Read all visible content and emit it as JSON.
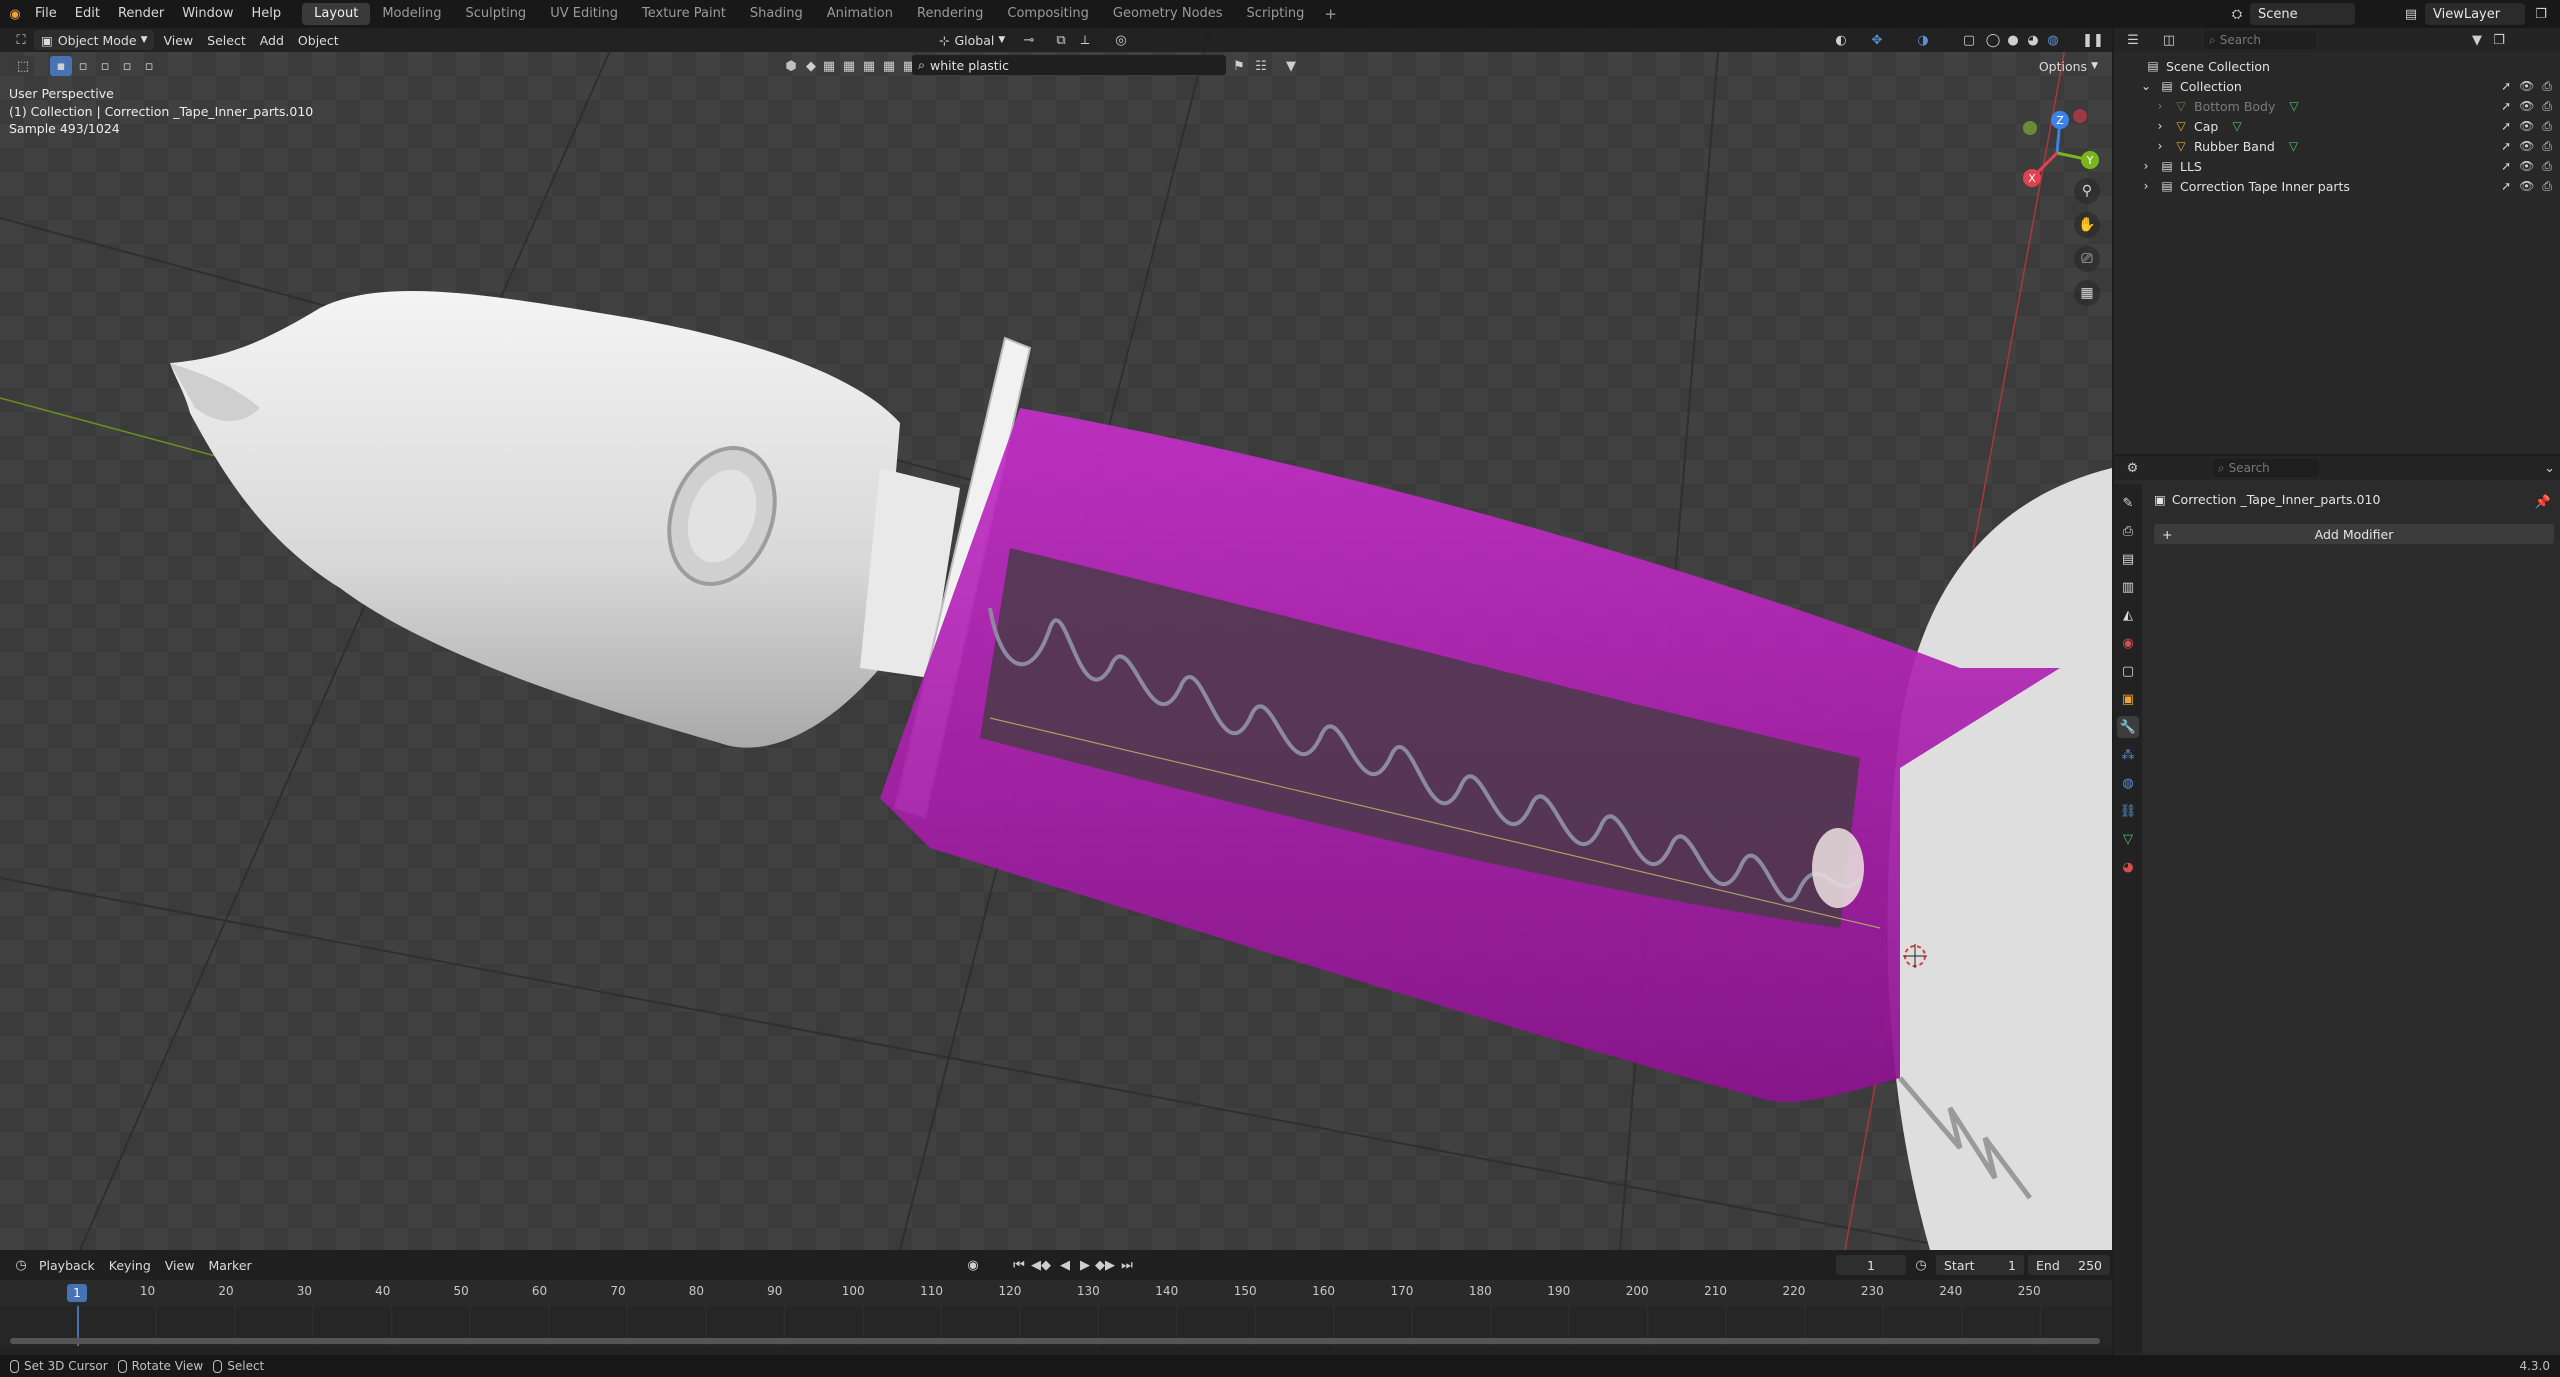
{
  "menubar": {
    "items": [
      "File",
      "Edit",
      "Render",
      "Window",
      "Help"
    ],
    "workspaces": [
      "Layout",
      "Modeling",
      "Sculpting",
      "UV Editing",
      "Texture Paint",
      "Shading",
      "Animation",
      "Rendering",
      "Compositing",
      "Geometry Nodes",
      "Scripting"
    ],
    "active_workspace": "Layout",
    "scene": "Scene",
    "view_layer": "ViewLayer"
  },
  "viewport": {
    "mode": "Object Mode",
    "menus": [
      "View",
      "Select",
      "Add",
      "Object"
    ],
    "transform_orientation": "Global",
    "material_search": "white plastic",
    "options_label": "Options",
    "info_lines": [
      "User Perspective",
      "(1) Collection | Correction _Tape_Inner_parts.010",
      "Sample 493/1024"
    ],
    "gizmo_axes": [
      "Z",
      "Y",
      "X"
    ]
  },
  "timeline": {
    "menus": [
      "Playback",
      "Keying",
      "View",
      "Marker"
    ],
    "current_frame": "1",
    "start_label": "Start",
    "start": "1",
    "end_label": "End",
    "end": "250",
    "ticks": [
      "1",
      "10",
      "20",
      "30",
      "40",
      "50",
      "60",
      "70",
      "80",
      "90",
      "100",
      "110",
      "120",
      "130",
      "140",
      "150",
      "160",
      "170",
      "180",
      "190",
      "200",
      "210",
      "220",
      "230",
      "240",
      "250"
    ]
  },
  "statusbar": {
    "items": [
      "Set 3D Cursor",
      "Rotate View",
      "Select"
    ],
    "version": "4.3.0"
  },
  "outliner": {
    "search_placeholder": "Search",
    "rows": [
      {
        "label": "Scene Collection",
        "indent": 0,
        "icon": "collection",
        "dim": false
      },
      {
        "label": "Collection",
        "indent": 1,
        "icon": "collection",
        "dim": false
      },
      {
        "label": "Bottom Body",
        "indent": 2,
        "icon": "mesh",
        "dim": true
      },
      {
        "label": "Cap",
        "indent": 2,
        "icon": "mesh",
        "dim": false
      },
      {
        "label": "Rubber Band",
        "indent": 2,
        "icon": "mesh",
        "dim": false
      },
      {
        "label": "LLS",
        "indent": 1,
        "icon": "collection",
        "dim": false
      },
      {
        "label": "Correction Tape Inner parts",
        "indent": 1,
        "icon": "collection",
        "dim": false
      }
    ]
  },
  "properties": {
    "search_placeholder": "Search",
    "object_name": "Correction _Tape_Inner_parts.010",
    "add_modifier": "Add Modifier"
  },
  "colors": {
    "accent": "#4772b3",
    "magenta": "#b21ab6",
    "x_axis": "#e4404f",
    "y_axis": "#7ab51d",
    "z_axis": "#3d82e6"
  }
}
